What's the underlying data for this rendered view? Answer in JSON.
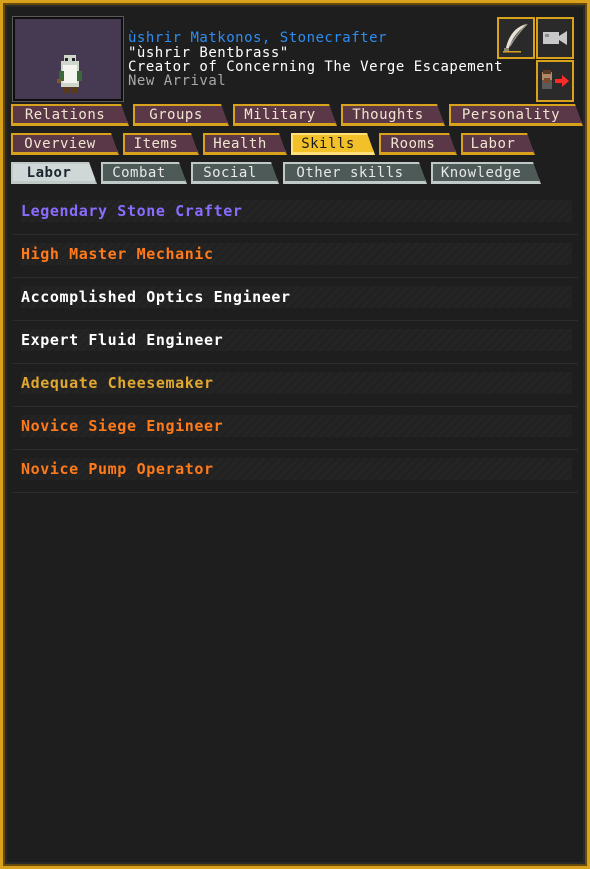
{
  "unit": {
    "name": "ùshrir Matkonos, Stonecrafter",
    "nickname": "\"ùshrir Bentbrass\"",
    "title": "Creator of Concerning The Verge Escapement",
    "status": "New Arrival"
  },
  "colors": {
    "frame": "#d9a21c",
    "name": "#2f8df0",
    "legendary": "#8a6cff",
    "master": "#ff7a1a",
    "accomplished": "#ffffff",
    "adequate": "#e0a830",
    "novice": "#ff7a1a"
  },
  "icons": {
    "quill": "quill-icon",
    "camera": "camera-icon",
    "leave": "leave-icon"
  },
  "tabs_main": [
    "Relations",
    "Groups",
    "Military",
    "Thoughts",
    "Personality"
  ],
  "tabs_sub": [
    "Overview",
    "Items",
    "Health",
    "Skills",
    "Rooms",
    "Labor"
  ],
  "tabs_sub_active": "Skills",
  "tabs_skill": [
    "Labor",
    "Combat",
    "Social",
    "Other skills",
    "Knowledge"
  ],
  "tabs_skill_active": "Labor",
  "skills": [
    {
      "label": "Legendary Stone Crafter",
      "color": "#8a6cff"
    },
    {
      "label": "High Master Mechanic",
      "color": "#ff7a1a"
    },
    {
      "label": "Accomplished Optics Engineer",
      "color": "#ffffff"
    },
    {
      "label": "Expert Fluid Engineer",
      "color": "#ffffff"
    },
    {
      "label": "Adequate Cheesemaker",
      "color": "#e0a830"
    },
    {
      "label": "Novice Siege Engineer",
      "color": "#ff7a1a"
    },
    {
      "label": "Novice Pump Operator",
      "color": "#ff7a1a"
    }
  ]
}
